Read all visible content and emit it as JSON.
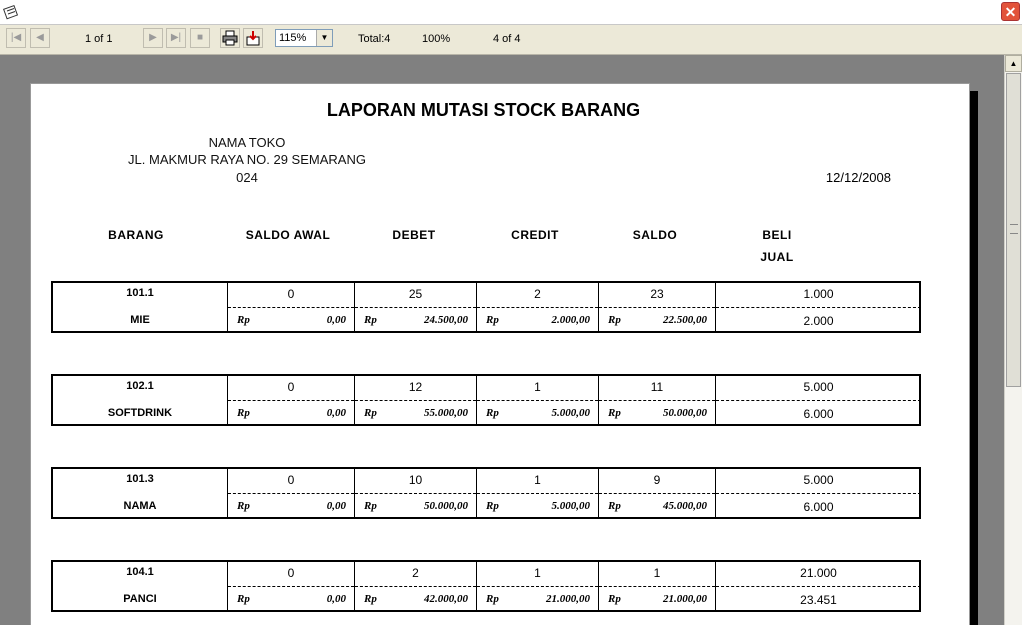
{
  "window": {
    "close_glyph": "✕"
  },
  "toolbar": {
    "first_glyph": "|◀",
    "prev_glyph": "◀",
    "page_indicator": "1 of 1",
    "next_glyph": "▶",
    "last_glyph": "▶|",
    "stop_glyph": "■",
    "zoom": "115%",
    "total": "Total:4",
    "percent": "100%",
    "records": "4 of 4"
  },
  "report": {
    "title": "LAPORAN MUTASI STOCK BARANG",
    "shop_name": "NAMA TOKO",
    "shop_address": "JL. MAKMUR RAYA NO. 29 SEMARANG",
    "shop_phone": "024",
    "date": "12/12/2008",
    "headers": {
      "barang": "BARANG",
      "saldo_awal": "SALDO AWAL",
      "debet": "DEBET",
      "credit": "CREDIT",
      "saldo": "SALDO",
      "beli": "BELI",
      "jual": "JUAL"
    },
    "currency": "Rp",
    "items": [
      {
        "code": "101.1",
        "name": "MIE",
        "saldo_awal": "0",
        "saldo_awal_rp": "0,00",
        "debet": "25",
        "debet_rp": "24.500,00",
        "credit": "2",
        "credit_rp": "2.000,00",
        "saldo": "23",
        "saldo_rp": "22.500,00",
        "beli": "1.000",
        "jual": "2.000"
      },
      {
        "code": "102.1",
        "name": "SOFTDRINK",
        "saldo_awal": "0",
        "saldo_awal_rp": "0,00",
        "debet": "12",
        "debet_rp": "55.000,00",
        "credit": "1",
        "credit_rp": "5.000,00",
        "saldo": "11",
        "saldo_rp": "50.000,00",
        "beli": "5.000",
        "jual": "6.000"
      },
      {
        "code": "101.3",
        "name": "NAMA",
        "saldo_awal": "0",
        "saldo_awal_rp": "0,00",
        "debet": "10",
        "debet_rp": "50.000,00",
        "credit": "1",
        "credit_rp": "5.000,00",
        "saldo": "9",
        "saldo_rp": "45.000,00",
        "beli": "5.000",
        "jual": "6.000"
      },
      {
        "code": "104.1",
        "name": "PANCI",
        "saldo_awal": "0",
        "saldo_awal_rp": "0,00",
        "debet": "2",
        "debet_rp": "42.000,00",
        "credit": "1",
        "credit_rp": "21.000,00",
        "saldo": "1",
        "saldo_rp": "21.000,00",
        "beli": "21.000",
        "jual": "23.451"
      }
    ]
  }
}
